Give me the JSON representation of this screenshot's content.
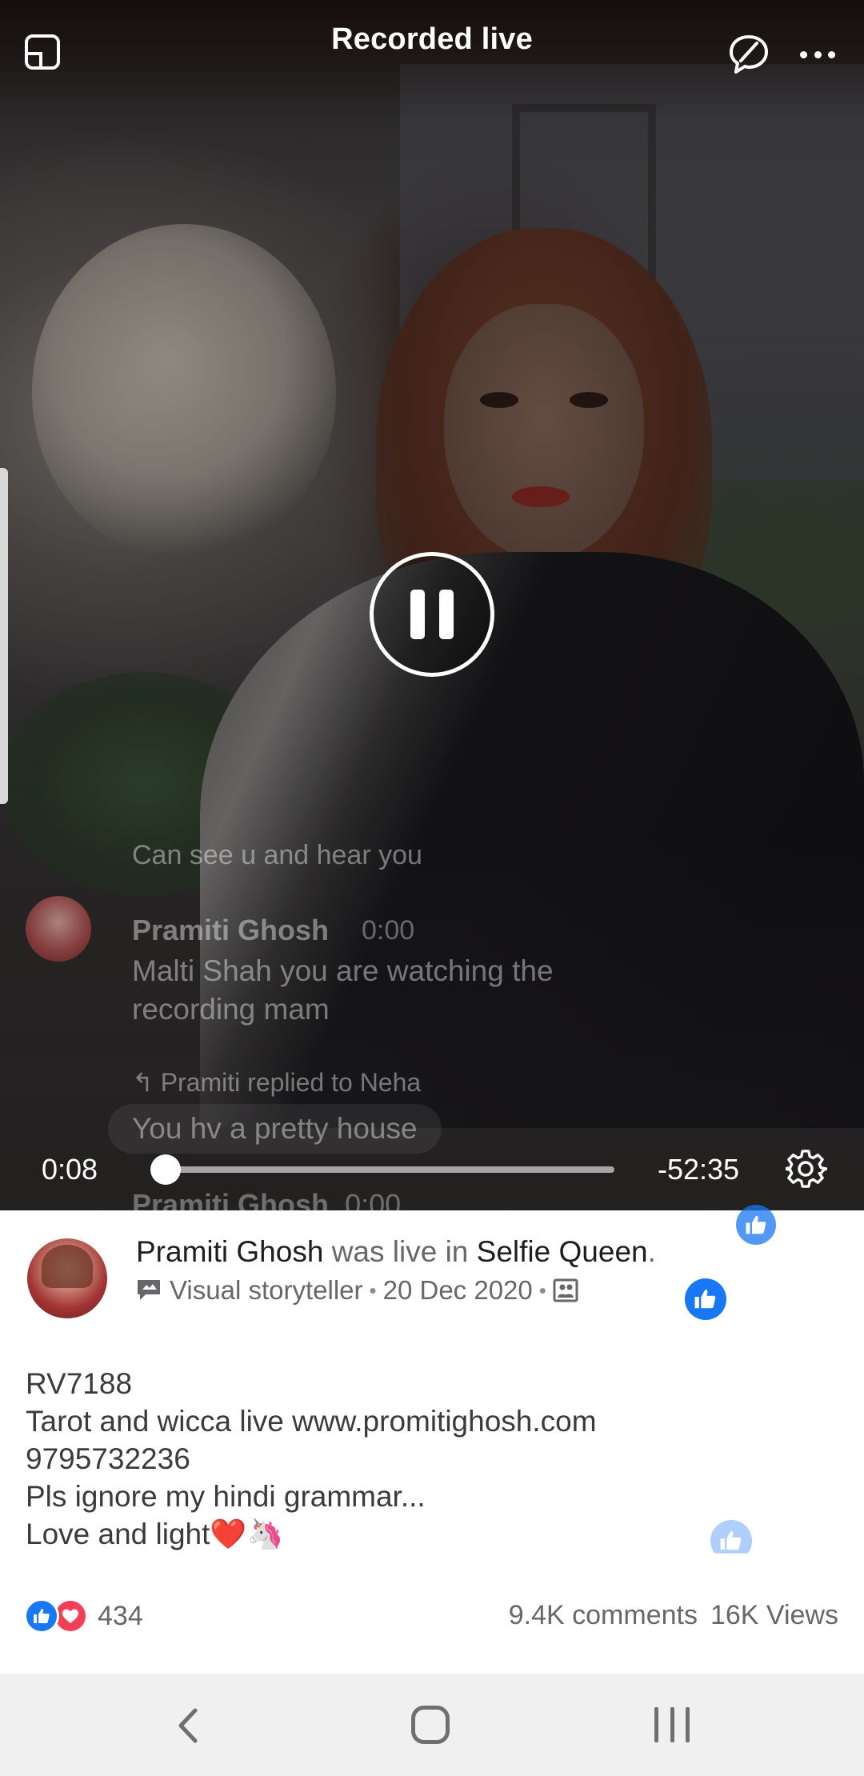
{
  "video": {
    "title": "Recorded live",
    "current_time": "0:08",
    "remaining_time": "-52:35",
    "progress_fraction": 0.02
  },
  "live_comments": {
    "partial_prev": "Can see u and hear you",
    "comment": {
      "author": "Pramiti Ghosh",
      "time": "0:00",
      "text": "Malti Shah you are watching the recording mam"
    },
    "reply_label": "Pramiti replied to Neha",
    "reply_text": "You hv a pretty house",
    "next_author": "Pramiti Ghosh",
    "next_time": "0:00"
  },
  "post": {
    "author": "Pramiti Ghosh",
    "was_live_in": "was live in",
    "group": "Selfie Queen",
    "period": ".",
    "badge": "Visual storyteller",
    "separator": "•",
    "date": "20 Dec 2020",
    "body_lines": [
      "RV7188",
      "Tarot and wicca live www.promitighosh.com",
      "9795732236",
      "Pls ignore my hindi grammar...",
      "Love and light❤️🦄"
    ],
    "reaction_count": "434",
    "comments": "9.4K comments",
    "views": "16K Views"
  },
  "colors": {
    "accent": "#1877f2",
    "love": "#f33e58",
    "muted_text": "#65676b",
    "navbar": "#f0f0f0"
  },
  "icons": [
    "picture-in-picture-icon",
    "comments-off-icon",
    "more-icon",
    "pause-icon",
    "gear-icon",
    "storyteller-icon",
    "audience-icon",
    "like-icon",
    "love-icon",
    "back-icon",
    "home-icon",
    "recents-icon"
  ]
}
